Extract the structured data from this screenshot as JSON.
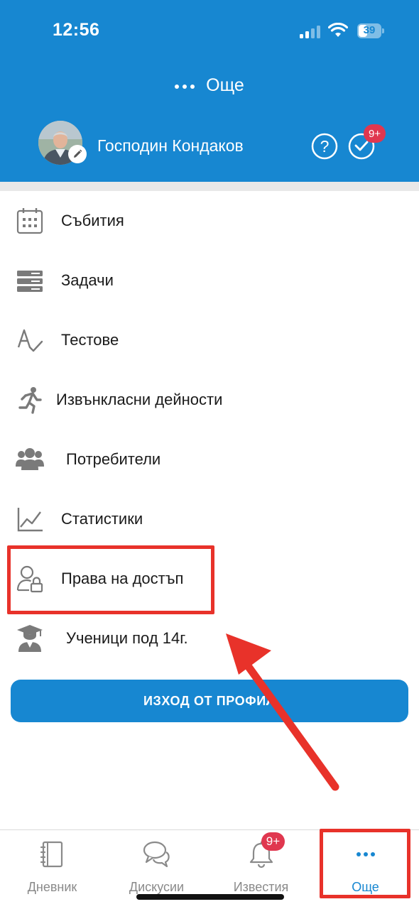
{
  "status_bar": {
    "time": "12:56",
    "battery": "39"
  },
  "header": {
    "title": "Още",
    "user_name": "Господин Кондаков",
    "notification_badge": "9+"
  },
  "menu": {
    "items": [
      {
        "label": "Събития",
        "icon": "calendar-icon"
      },
      {
        "label": "Задачи",
        "icon": "tasks-icon"
      },
      {
        "label": "Тестове",
        "icon": "tests-icon"
      },
      {
        "label": "Извънкласни дейности",
        "icon": "running-person-icon"
      },
      {
        "label": "Потребители",
        "icon": "users-icon"
      },
      {
        "label": "Статистики",
        "icon": "statistics-icon"
      },
      {
        "label": "Права на достъп",
        "icon": "user-lock-icon"
      },
      {
        "label": "Ученици под 14г.",
        "icon": "graduate-icon"
      }
    ],
    "logout_label": "ИЗХОД ОТ ПРОФИЛ"
  },
  "tabbar": {
    "tabs": [
      {
        "label": "Дневник",
        "icon": "journal-icon"
      },
      {
        "label": "Дискусии",
        "icon": "chat-icon"
      },
      {
        "label": "Известия",
        "icon": "bell-icon"
      },
      {
        "label": "Още",
        "icon": "more-icon"
      }
    ],
    "notifications_badge": "9+"
  },
  "colors": {
    "brand": "#1787d1",
    "badge": "#e0374f",
    "annotation": "#e8322a",
    "icon_gray": "#7a7a7a"
  }
}
